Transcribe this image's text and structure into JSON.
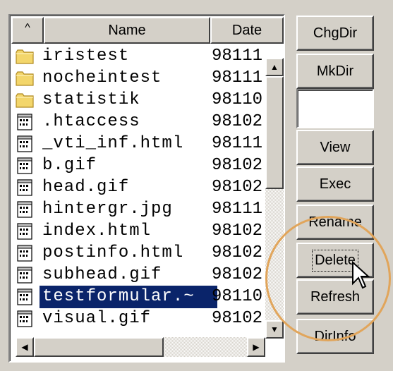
{
  "columns": {
    "sort": "^",
    "name": "Name",
    "date": "Date"
  },
  "files": [
    {
      "name": "iristest",
      "date": "98111",
      "icon": "folder-icon",
      "selected": false
    },
    {
      "name": "nocheintest",
      "date": "98111",
      "icon": "folder-icon",
      "selected": false
    },
    {
      "name": "statistik",
      "date": "98110",
      "icon": "folder-icon",
      "selected": false
    },
    {
      "name": ".htaccess",
      "date": "98102",
      "icon": "file-icon",
      "selected": false
    },
    {
      "name": "_vti_inf.html",
      "date": "98111",
      "icon": "file-icon",
      "selected": false
    },
    {
      "name": "b.gif",
      "date": "98102",
      "icon": "file-icon",
      "selected": false
    },
    {
      "name": "head.gif",
      "date": "98102",
      "icon": "file-icon",
      "selected": false
    },
    {
      "name": "hintergr.jpg",
      "date": "98111",
      "icon": "file-icon",
      "selected": false
    },
    {
      "name": "index.html",
      "date": "98102",
      "icon": "file-icon",
      "selected": false
    },
    {
      "name": "postinfo.html",
      "date": "98102",
      "icon": "file-icon",
      "selected": false
    },
    {
      "name": "subhead.gif",
      "date": "98102",
      "icon": "file-icon",
      "selected": false
    },
    {
      "name": "testformular.~",
      "date": "98110",
      "icon": "file-icon",
      "selected": true
    },
    {
      "name": "visual.gif",
      "date": "98102",
      "icon": "file-icon",
      "selected": false
    }
  ],
  "buttons": {
    "chgdir": "ChgDir",
    "mkdir": "MkDir",
    "view": "View",
    "exec": "Exec",
    "rename": "Rename",
    "delete": "Delete",
    "refresh": "Refresh",
    "dirinfo": "DirInfo"
  },
  "dir_input": {
    "value": ""
  },
  "scroll_glyphs": {
    "up": "▲",
    "down": "▼",
    "left": "◀",
    "right": "▶"
  },
  "colors": {
    "selection": "#0a246a",
    "highlight_circle": "#e1a55b",
    "face": "#d4d0c8"
  }
}
